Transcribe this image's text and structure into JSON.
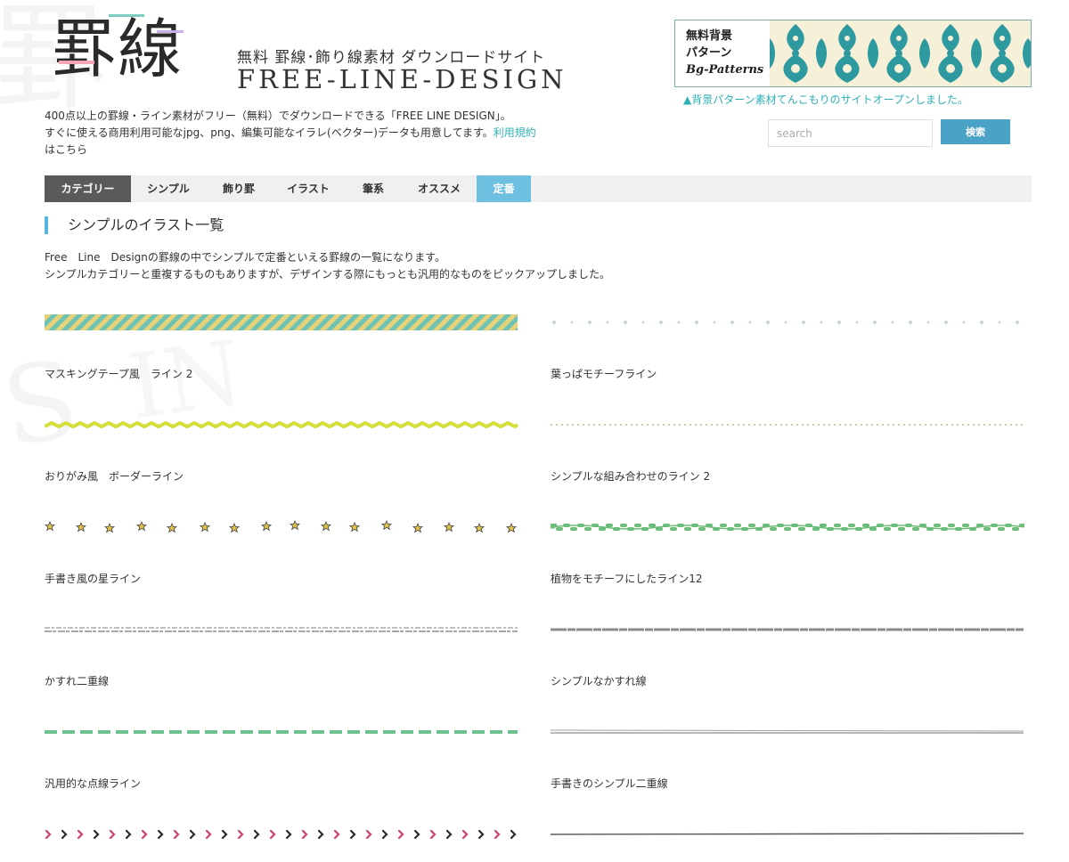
{
  "header": {
    "logo_text": "罫線",
    "tagline": "無料 罫線･飾り線素材 ダウンロードサイト",
    "brand": "FREE-LINE-DESIGN"
  },
  "banner": {
    "line1": "無料背景",
    "line2": "パターン",
    "line3": "Bg-Patterns",
    "note": "▲背景パターン素材てんこもりのサイトオープンしました。"
  },
  "intro": {
    "line1": "400点以上の罫線・ライン素材がフリー（無料）でダウンロードできる「FREE LINE DESIGN」。",
    "line2": "すぐに使える商用利用可能なjpg、png、編集可能なイラレ(ベクター)データも用意してます。",
    "link": "利用規約",
    "line3": "はこちら"
  },
  "search": {
    "placeholder": "search",
    "button_label": "検索"
  },
  "nav": [
    {
      "label": "カテゴリー"
    },
    {
      "label": "シンプル"
    },
    {
      "label": "飾り罫"
    },
    {
      "label": "イラスト"
    },
    {
      "label": "筆系"
    },
    {
      "label": "オススメ"
    },
    {
      "label": "定番"
    }
  ],
  "section": {
    "title": "シンプルのイラスト一覧",
    "desc1": "Free　Line　Designの罫線の中でシンプルで定番といえる罫線の一覧になります。",
    "desc2": "シンプルカテゴリーと重複するものもありますが、デザインする際にもっとも汎用的なものをピックアップしました。"
  },
  "items": [
    {
      "label": "マスキングテープ風　ライン 2"
    },
    {
      "label": "葉っぱモチーフライン"
    },
    {
      "label": "おりがみ風　ボーダーライン"
    },
    {
      "label": "シンプルな組み合わせのライン 2"
    },
    {
      "label": "手書き風の星ライン"
    },
    {
      "label": "植物をモチーフにしたライン12"
    },
    {
      "label": "かすれ二重線"
    },
    {
      "label": "シンプルなかすれ線"
    },
    {
      "label": "汎用的な点線ライン"
    },
    {
      "label": "手書きのシンプル二重線"
    }
  ],
  "colors": {
    "accent_teal": "#2eb0b5",
    "nav_active": "#5a5a5a",
    "nav_highlight": "#6ec0e0",
    "search_button": "#4aa3c7",
    "section_bar": "#56b6e0",
    "banner_pattern": "#2e9a9f"
  }
}
